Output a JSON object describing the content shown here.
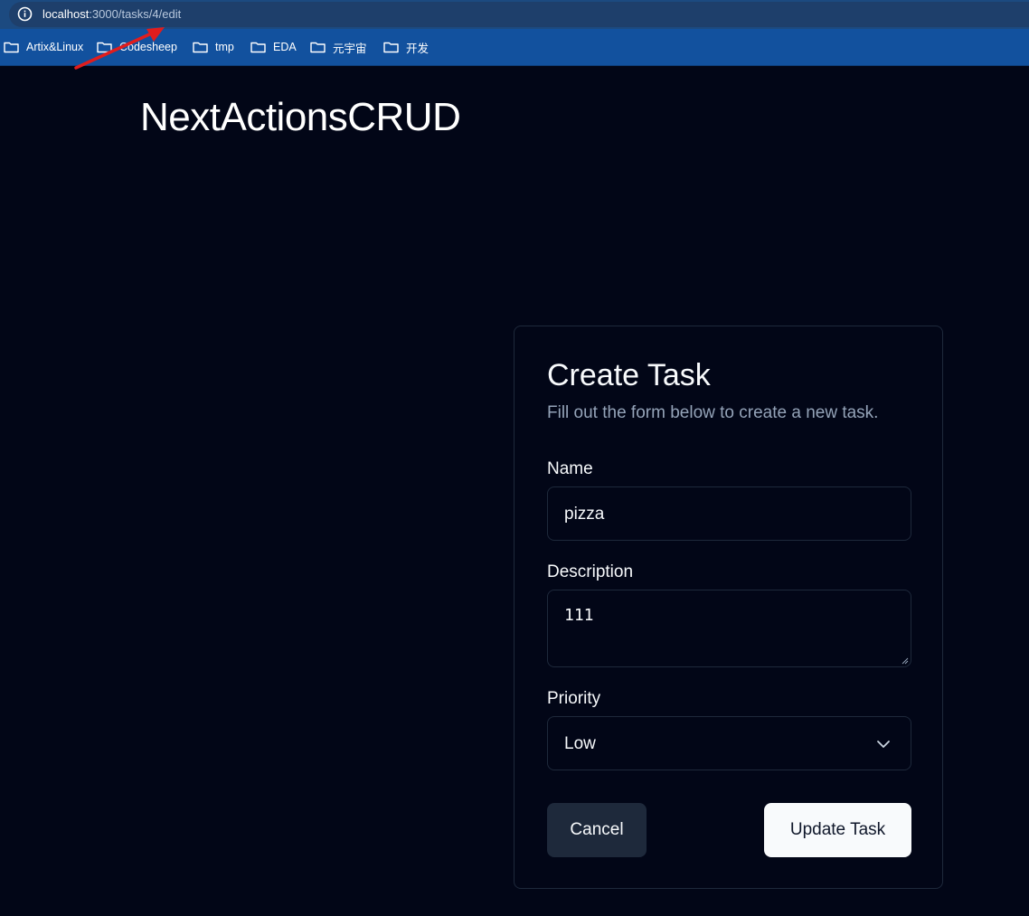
{
  "browser": {
    "url_host": "localhost",
    "url_path": ":3000/tasks/4/edit",
    "bookmarks": [
      "Artix&Linux",
      "Codesheep",
      "tmp",
      "EDA",
      "元宇宙",
      "开发"
    ]
  },
  "app": {
    "title": "NextActionsCRUD"
  },
  "form": {
    "title": "Create Task",
    "description": "Fill out the form below to create a new task.",
    "name_label": "Name",
    "name_value": "pizza",
    "description_label": "Description",
    "description_value": "111",
    "priority_label": "Priority",
    "priority_value": "Low",
    "cancel_label": "Cancel",
    "submit_label": "Update Task"
  },
  "colors": {
    "background": "#020617",
    "browser_toolbar": "#12519e",
    "card_border": "#1e293b",
    "muted_text": "#94a3b8",
    "annotation_arrow": "#e11d1d"
  }
}
